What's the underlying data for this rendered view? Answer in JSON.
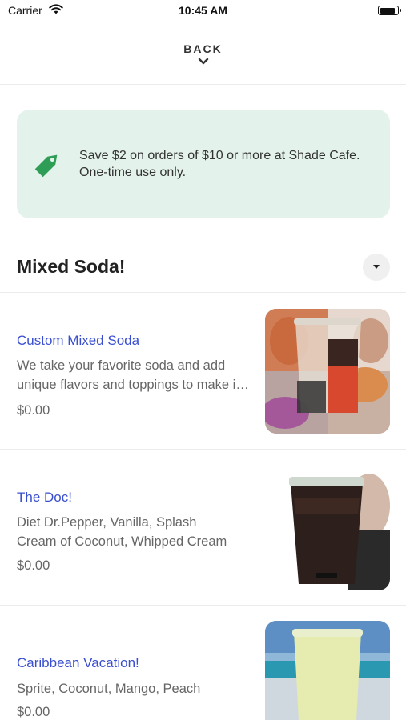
{
  "status_bar": {
    "carrier": "Carrier",
    "time": "10:45 AM",
    "battery_level": 0.9
  },
  "nav": {
    "back_label": "BACK"
  },
  "promo": {
    "text": "Save $2 on orders of $10 or more at Shade Cafe. One-time use only.",
    "icon": "tag-icon",
    "color": "#2e9e57",
    "background": "#e3f2ea"
  },
  "section": {
    "title": "Mixed Soda!"
  },
  "items": [
    {
      "name": "Custom Mixed Soda",
      "desc_line1": "We take your favorite soda and add",
      "desc_line2": "unique flavors and toppings to make it your own",
      "price": "$0.00"
    },
    {
      "name": "The Doc!",
      "desc_line1": "Diet Dr.Pepper, Vanilla, Splash",
      "desc_line2": "Cream of Coconut, Whipped Cream",
      "price": "$0.00"
    },
    {
      "name": "Caribbean Vacation!",
      "desc_line1": "Sprite, Coconut, Mango, Peach",
      "desc_line2": "",
      "price": "$0.00"
    }
  ],
  "colors": {
    "accent": "#3a4fd0",
    "text_muted": "#666666"
  }
}
